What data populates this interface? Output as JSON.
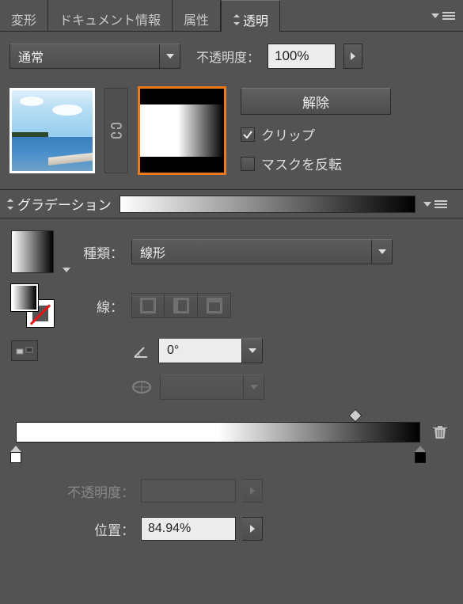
{
  "tabs": {
    "transform": "変形",
    "docinfo": "ドキュメント情報",
    "attributes": "属性",
    "transparency": "透明"
  },
  "transparency": {
    "blend_mode": "通常",
    "opacity_label": "不透明度：",
    "opacity_value": "100%",
    "release_label": "解除",
    "clip_label": "クリップ",
    "invert_label": "マスクを反転",
    "clip_checked": true,
    "invert_checked": false
  },
  "gradient": {
    "title": "グラデーション",
    "type_label": "種類：",
    "type_value": "線形",
    "stroke_label": "線：",
    "angle_value": "0°",
    "aspect_value": "",
    "slider": {
      "midpoint_pct": 84,
      "stops": [
        {
          "color": "#ffffff",
          "pos": 0
        },
        {
          "color": "#000000",
          "pos": 100
        }
      ]
    },
    "stop_opacity_label": "不透明度：",
    "stop_opacity_value": "",
    "location_label": "位置：",
    "location_value": "84.94%"
  }
}
